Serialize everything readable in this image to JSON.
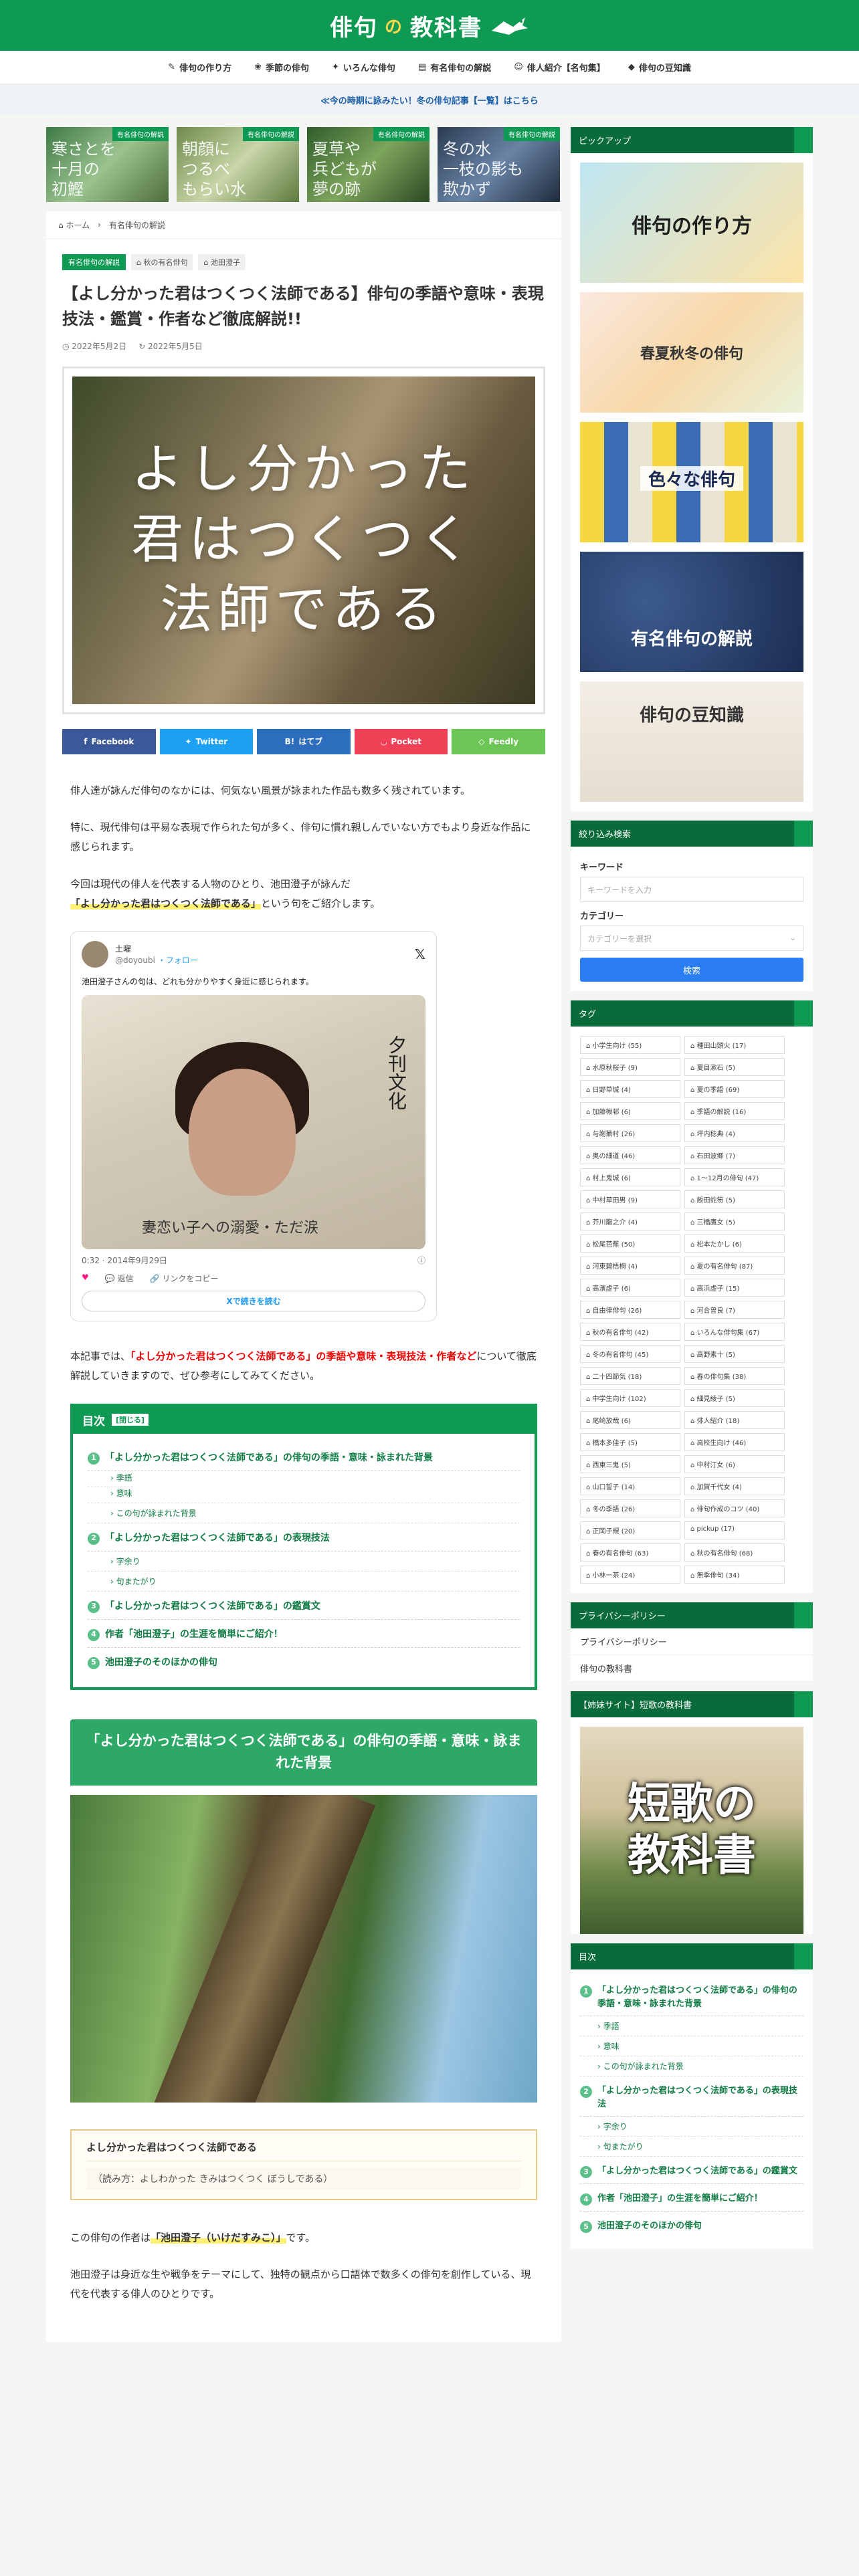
{
  "header": {
    "logo_main": "俳句",
    "logo_no": "の",
    "logo_tail": "教科書"
  },
  "nav": [
    {
      "icon": "pen-icon",
      "label": "俳句の作り方"
    },
    {
      "icon": "flower-icon",
      "label": "季節の俳句"
    },
    {
      "icon": "gift-icon",
      "label": "いろんな俳句"
    },
    {
      "icon": "book-icon",
      "label": "有名俳句の解説"
    },
    {
      "icon": "user-icon",
      "label": "俳人紹介【名句集】"
    },
    {
      "icon": "graduation-icon",
      "label": "俳句の豆知識"
    }
  ],
  "notice": "≪今の時期に詠みたい！冬の俳句記事【一覧】はこちら",
  "carousel": [
    {
      "category": "有名俳句の解説",
      "text": "寒さとを\n十月の\n初鰹"
    },
    {
      "category": "有名俳句の解説",
      "text": "朝顔に\nつるべ\nもらい水"
    },
    {
      "category": "有名俳句の解説",
      "text": "夏草や\n兵どもが\n夢の跡"
    },
    {
      "category": "有名俳句の解説",
      "text": "冬の水\n一枝の影も\n欺かず"
    }
  ],
  "breadcrumb": {
    "home": "ホーム",
    "current": "有名俳句の解説"
  },
  "article": {
    "category": "有名俳句の解説",
    "tags": [
      "秋の有名俳句",
      "池田澄子"
    ],
    "title": "【よし分かった君はつくつく法師である】俳句の季語や意味・表現技法・鑑賞・作者など徹底解説!!",
    "published": "2022年5月2日",
    "updated": "2022年5月5日",
    "eyecatch_lines": [
      "よし分かった",
      "君はつくつく",
      "法師である"
    ]
  },
  "share": [
    {
      "label": "Facebook",
      "color": "#3b5998",
      "icon": "facebook-icon"
    },
    {
      "label": "Twitter",
      "color": "#1da1f2",
      "icon": "twitter-icon"
    },
    {
      "label": "はてブ",
      "color": "#2c6ebd",
      "icon": "hatena-icon"
    },
    {
      "label": "Pocket",
      "color": "#ef4056",
      "icon": "pocket-icon"
    },
    {
      "label": "Feedly",
      "color": "#6cc655",
      "icon": "feedly-icon"
    }
  ],
  "intro": {
    "p1": "俳人達が詠んだ俳句のなかには、何気ない風景が詠まれた作品も数多く残されています。",
    "p2": "特に、現代俳句は平易な表現で作られた句が多く、俳句に慣れ親しんでいない方でもより身近な作品に感じられます。",
    "p3_before": "今回は現代の俳人を代表する人物のひとり、池田澄子が詠んだ",
    "p3_mark": "「よし分かった君はつくつく法師である」",
    "p3_after": "という句をご紹介します。"
  },
  "tweet": {
    "name": "土曜",
    "handle": "@doyoubi",
    "follow": "・フォロー",
    "text": "池田澄子さんの句は、どれも分かりやすく身近に感じられます。",
    "photo_heading": "夕刊文化",
    "photo_caption": "妻恋い子への溺愛・ただ涙",
    "time": "0:32 · 2014年9月29日",
    "like": "返信",
    "reply": "返信",
    "copy": "リンクをコピー",
    "more": "Xで続きを読む"
  },
  "summary": {
    "before": "本記事では、",
    "red": "「よし分かった君はつくつく法師である」の季語や意味・表現技法・作者など",
    "after": "について徹底解説していきますので、ぜひ参考にしてみてください。"
  },
  "toc": {
    "title": "目次",
    "toggle": "[閉じる]",
    "items": [
      {
        "num": "1",
        "label": "「よし分かった君はつくつく法師である」の俳句の季語・意味・詠まれた背景",
        "children": [
          "季語",
          "意味",
          "この句が詠まれた背景"
        ]
      },
      {
        "num": "2",
        "label": "「よし分かった君はつくつく法師である」の表現技法",
        "children": [
          "字余り",
          "句またがり"
        ]
      },
      {
        "num": "3",
        "label": "「よし分かった君はつくつく法師である」の鑑賞文",
        "children": []
      },
      {
        "num": "4",
        "label": "作者「池田澄子」の生涯を簡単にご紹介！",
        "children": []
      },
      {
        "num": "5",
        "label": "池田澄子のそのほかの俳句",
        "children": []
      }
    ]
  },
  "section1": {
    "heading": "「よし分かった君はつくつく法師である」の俳句の季語・意味・詠まれた背景",
    "box_title": "よし分かった君はつくつく法師である",
    "box_reading": "（読み方：よしわかった きみはつくつく ぼうしである）",
    "p_author_before": "この俳句の作者は",
    "p_author_mark": "「池田澄子（いけだすみこ）」",
    "p_author_after": "です。",
    "p_bio": "池田澄子は身近な生や戦争をテーマにして、独特の観点から口語体で数多くの俳句を創作している、現代を代表する俳人のひとりです。"
  },
  "sidebar": {
    "pickup_title": "ピックアップ",
    "pickups": [
      "俳句の作り方",
      "春夏秋冬の俳句",
      "色々な俳句",
      "有名俳句の解説",
      "俳句の豆知識"
    ],
    "search_title": "絞り込み検索",
    "keyword_label": "キーワード",
    "keyword_placeholder": "キーワードを入力",
    "category_label": "カテゴリー",
    "category_placeholder": "カテゴリーを選択",
    "search_button": "検索",
    "tags_title": "タグ",
    "tags": [
      "小学生向け (55)",
      "種田山頭火 (17)",
      "水原秋桜子 (9)",
      "夏目漱石 (5)",
      "日野草城 (4)",
      "夏の季語 (69)",
      "加藤楸邨 (6)",
      "季語の解説 (16)",
      "与謝蕪村 (26)",
      "坪内稔典 (4)",
      "奥の細道 (46)",
      "石田波郷 (7)",
      "村上鬼城 (6)",
      "1〜12月の俳句 (47)",
      "中村草田男 (9)",
      "飯田蛇笏 (5)",
      "芥川龍之介 (4)",
      "三橋鷹女 (5)",
      "松尾芭蕉 (50)",
      "松本たかし (6)",
      "河東碧梧桐 (4)",
      "夏の有名俳句 (87)",
      "高濱虚子 (6)",
      "高浜虚子 (15)",
      "自由律俳句 (26)",
      "河合曽良 (7)",
      "秋の有名俳句 (42)",
      "いろんな俳句集 (67)",
      "冬の有名俳句 (45)",
      "高野素十 (5)",
      "二十四節気 (18)",
      "春の俳句集 (38)",
      "中学生向け (102)",
      "細見綾子 (5)",
      "尾崎放哉 (6)",
      "俳人紹介 (18)",
      "橋本多佳子 (5)",
      "高校生向け (46)",
      "西東三鬼 (5)",
      "中村汀女 (6)",
      "山口誓子 (14)",
      "加賀千代女 (4)",
      "冬の季語 (26)",
      "俳句作成のコツ (40)",
      "正岡子規 (20)",
      "pickup (17)",
      "春の有名俳句 (63)",
      "秋の有名俳句 (68)",
      "小林一茶 (24)",
      "無季俳句 (34)"
    ],
    "privacy_title": "プライバシーポリシー",
    "privacy_links": [
      "プライバシーポリシー",
      "俳句の教科書"
    ],
    "sister_title": "【姉妹サイト】短歌の教科書",
    "sister_banner": [
      "短歌の",
      "教科書"
    ],
    "toc_title": "目次"
  }
}
